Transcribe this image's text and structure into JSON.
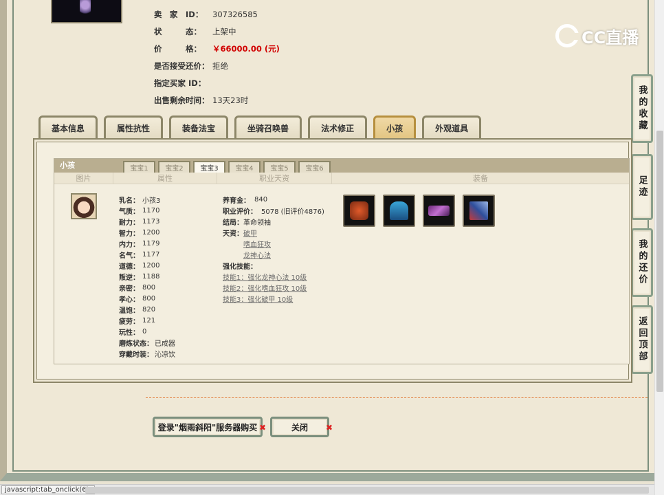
{
  "seller": {
    "rows": [
      {
        "label": "卖　家　ID：",
        "value": "307326585",
        "type": "normal"
      },
      {
        "label": "状　　　态：",
        "value": "上架中",
        "type": "normal"
      },
      {
        "label": "价　　　格：",
        "value": "￥66000.00 (元)",
        "type": "price"
      },
      {
        "label": "是否接受还价：",
        "value": "拒绝",
        "type": "normal"
      },
      {
        "label": "指定买家 ID：",
        "value": "",
        "type": "normal"
      },
      {
        "label": "出售剩余时间：",
        "value": "13天23时",
        "type": "normal"
      }
    ]
  },
  "logo_text": "CC直播",
  "side_buttons": [
    "我的收藏",
    "足迹",
    "我的还价",
    "返回顶部"
  ],
  "tabs": [
    {
      "label": "基本信息",
      "active": false
    },
    {
      "label": "属性抗性",
      "active": false
    },
    {
      "label": "装备法宝",
      "active": false
    },
    {
      "label": "坐骑召唤兽",
      "active": false
    },
    {
      "label": "法术修正",
      "active": false
    },
    {
      "label": "小孩",
      "active": true
    },
    {
      "label": "外观道具",
      "active": false
    }
  ],
  "child_panel": {
    "title": "小孩",
    "subtabs": [
      {
        "label": "宝宝1",
        "active": false
      },
      {
        "label": "宝宝2",
        "active": false
      },
      {
        "label": "宝宝3",
        "active": true
      },
      {
        "label": "宝宝4",
        "active": false
      },
      {
        "label": "宝宝5",
        "active": false
      },
      {
        "label": "宝宝6",
        "active": false
      }
    ],
    "columns": [
      "图片",
      "属性",
      "职业天资",
      "装备"
    ],
    "attributes": [
      {
        "label": "乳名：",
        "value": "小孩3"
      },
      {
        "label": "气质：",
        "value": "1170"
      },
      {
        "label": "耐力：",
        "value": "1173"
      },
      {
        "label": "智力：",
        "value": "1200"
      },
      {
        "label": "内力：",
        "value": "1179"
      },
      {
        "label": "名气：",
        "value": "1177"
      },
      {
        "label": "道德：",
        "value": "1200"
      },
      {
        "label": "叛逆：",
        "value": "1188"
      },
      {
        "label": "亲密：",
        "value": "800"
      },
      {
        "label": "孝心：",
        "value": "800"
      },
      {
        "label": "温饱：",
        "value": "820"
      },
      {
        "label": "疲劳：",
        "value": "121"
      },
      {
        "label": "玩性：",
        "value": "0"
      },
      {
        "label": "磨炼状态：",
        "value": "已成器"
      },
      {
        "label": "穿戴时装：",
        "value": "沁凉饮"
      }
    ],
    "career": {
      "upbringing_label": "养育金：",
      "upbringing_value": "840",
      "rating_label": "职业评价：",
      "rating_value": "5078 (旧评价4876)",
      "ending_label": "结局：",
      "ending_value": "革命领袖",
      "talent_label": "天资：",
      "talents": [
        "破甲",
        "嗜血狂攻",
        "龙神心法"
      ],
      "skills_label": "强化技能：",
      "skills": [
        "技能1：强化龙神心法 10级",
        "技能2：强化嗜血狂攻 10级",
        "技能3：强化破甲 10级"
      ]
    },
    "equipment_icons": [
      "red-armor-icon",
      "blue-robe-icon",
      "purple-scroll-icon",
      "blue-weapon-icon"
    ]
  },
  "actions": {
    "login_label": "登录\"烟雨斜阳\"服务器购买",
    "close_label": "关闭"
  },
  "status_text": "javascript:tab_onclick(6);",
  "colors": {
    "price": "#d10000",
    "panel_border": "#8c8668",
    "active_tab": "#e2c582"
  }
}
